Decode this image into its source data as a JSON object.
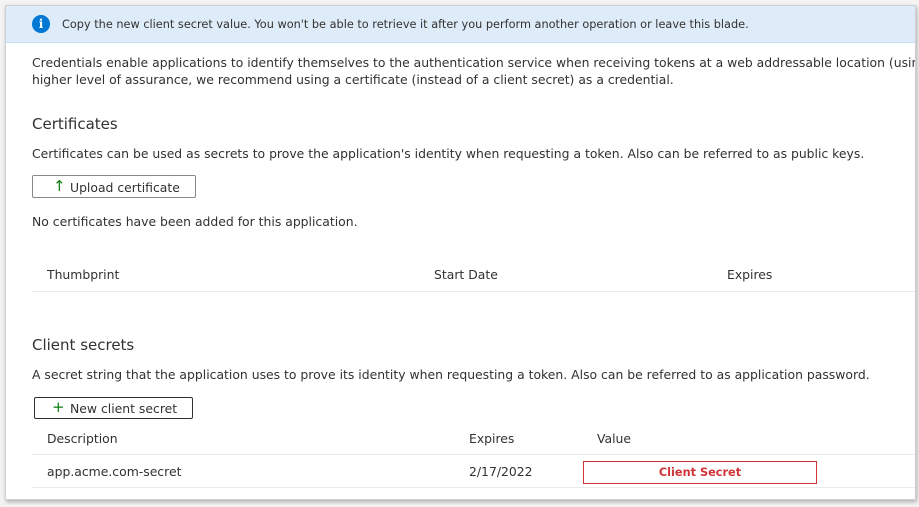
{
  "banner": {
    "message": "Copy the new client secret value. You won't be able to retrieve it after you perform another operation or leave this blade.",
    "icon": "info-icon"
  },
  "intro": {
    "line1": "Credentials enable applications to identify themselves to the authentication service when receiving tokens at a web addressable location (using an HTTP",
    "line2": "higher level of assurance, we recommend using a certificate (instead of a client secret) as a credential."
  },
  "certificates": {
    "heading": "Certificates",
    "description": "Certificates can be used as secrets to prove the application's identity when requesting a token. Also can be referred to as public keys.",
    "upload_label": "Upload certificate",
    "upload_icon": "upload-arrow-icon",
    "empty_message": "No certificates have been added for this application.",
    "columns": [
      "Thumbprint",
      "Start Date",
      "Expires"
    ]
  },
  "client_secrets": {
    "heading": "Client secrets",
    "description": "A secret string that the application uses to prove its identity when requesting a token. Also can be referred to as application password.",
    "new_label": "New client secret",
    "new_icon": "plus-icon",
    "columns": [
      "Description",
      "Expires",
      "Value"
    ],
    "rows": [
      {
        "description": "app.acme.com-secret",
        "expires": "2/17/2022",
        "value": "Client Secret"
      }
    ]
  },
  "colors": {
    "banner_bg": "#deecf9",
    "info_blue": "#0078d4",
    "green_icon": "#107c10",
    "secret_red": "#d13438"
  }
}
